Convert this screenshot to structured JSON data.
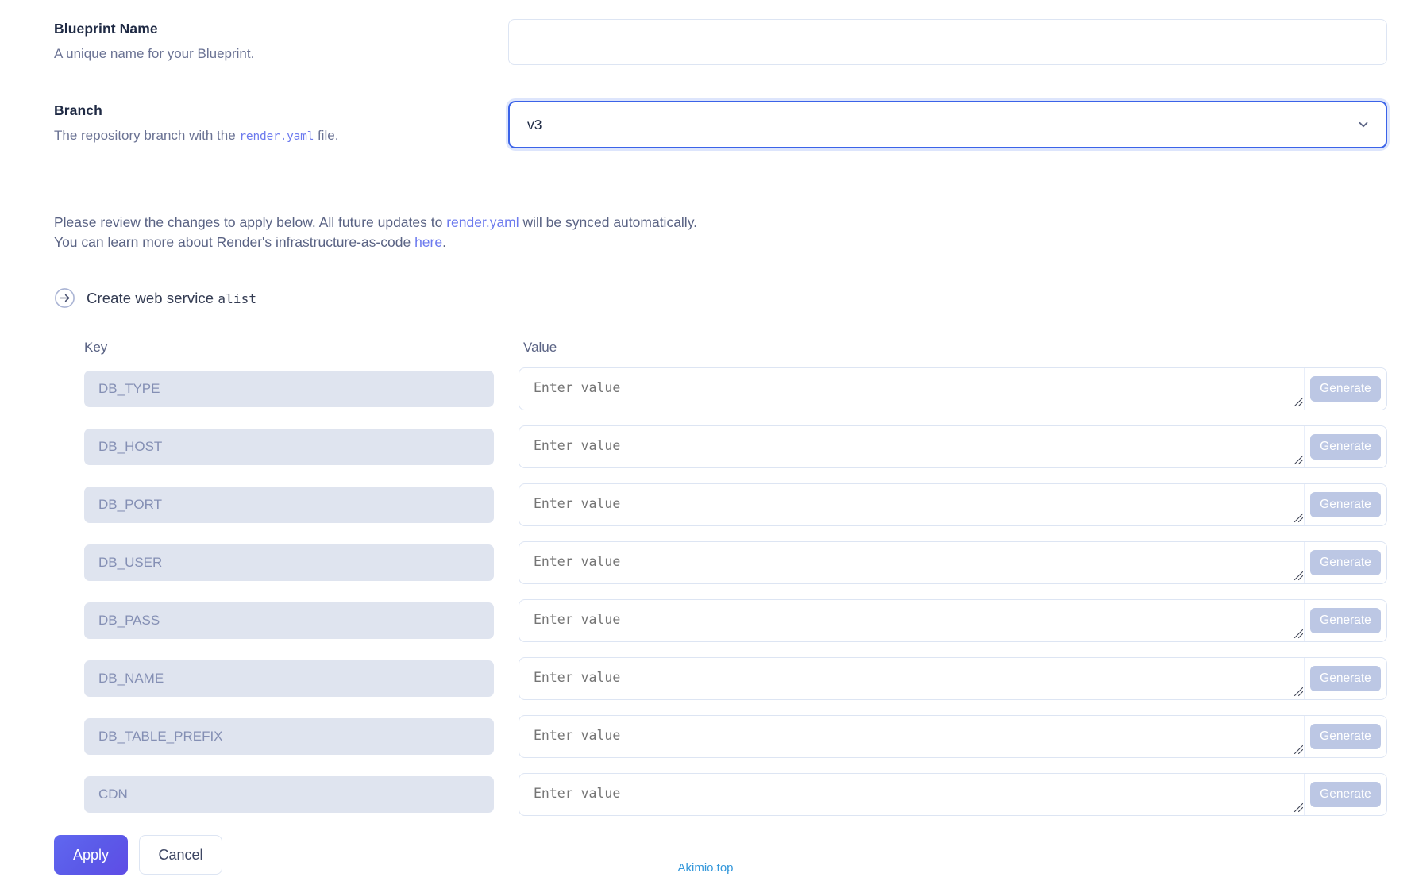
{
  "blueprint_name": {
    "title": "Blueprint Name",
    "description": "A unique name for your Blueprint.",
    "value": "",
    "placeholder": ""
  },
  "branch": {
    "title": "Branch",
    "desc_before": "The repository branch with the ",
    "desc_code": "render.yaml",
    "desc_after": " file.",
    "value": "v3",
    "chevron_icon": "chevron-down-icon"
  },
  "notice": {
    "line1_before": "Please review the changes to apply below. All future updates to ",
    "line1_link": "render.yaml",
    "line1_after": " will be synced automatically.",
    "line2_before": "You can learn more about Render's infrastructure-as-code ",
    "line2_link": "here",
    "line2_after": "."
  },
  "service": {
    "icon": "arrow-right-circle-icon",
    "action_text": "Create web service ",
    "service_name": "alist"
  },
  "env_table": {
    "key_header": "Key",
    "value_header": "Value",
    "value_placeholder": "Enter value",
    "generate_label": "Generate",
    "rows": [
      {
        "key": "DB_TYPE",
        "value": ""
      },
      {
        "key": "DB_HOST",
        "value": ""
      },
      {
        "key": "DB_PORT",
        "value": ""
      },
      {
        "key": "DB_USER",
        "value": ""
      },
      {
        "key": "DB_PASS",
        "value": ""
      },
      {
        "key": "DB_NAME",
        "value": ""
      },
      {
        "key": "DB_TABLE_PREFIX",
        "value": ""
      },
      {
        "key": "CDN",
        "value": ""
      }
    ]
  },
  "footer": {
    "apply_label": "Apply",
    "cancel_label": "Cancel"
  },
  "watermark": {
    "text": "Akimio.top"
  },
  "colors": {
    "accent": "#5b5ae8",
    "link": "#6c7aee",
    "key_field_bg": "#dfe4ef",
    "generate_bg": "#bcc7e4",
    "focus_border": "#3b63e8",
    "watermark": "#3498db"
  }
}
